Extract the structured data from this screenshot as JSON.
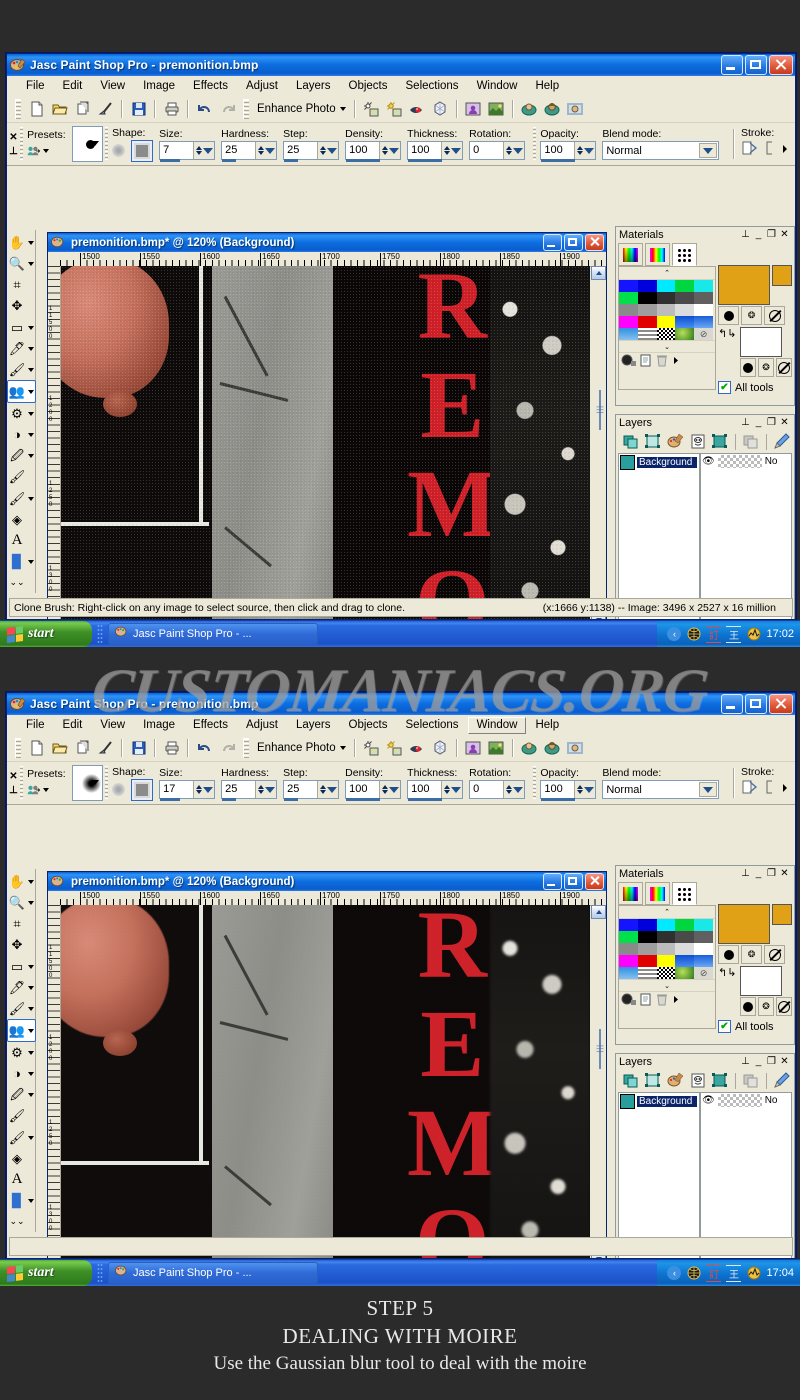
{
  "app": {
    "title": "Jasc Paint Shop Pro - premonition.bmp",
    "menu": [
      "File",
      "Edit",
      "View",
      "Image",
      "Effects",
      "Adjust",
      "Layers",
      "Objects",
      "Selections",
      "Window",
      "Help"
    ],
    "toolbar": {
      "enhance_label": "Enhance Photo",
      "icons": [
        "new-file-icon",
        "open-folder-icon",
        "browse-icon",
        "twain-acquire-icon",
        "save-icon",
        "print-icon",
        "undo-icon",
        "redo-icon",
        "auto-contrast-icon",
        "auto-brightness-icon",
        "red-eye-icon",
        "clarify-icon",
        "photo-person-icon",
        "photo-landscape-icon",
        "photo-frame-icon",
        "photo-vignette-icon",
        "photo-edge-icon"
      ]
    }
  },
  "tool_options": {
    "presets_label": "Presets:",
    "shape_label": "Shape:",
    "size_label": "Size:",
    "hardness_label": "Hardness:",
    "step_label": "Step:",
    "density_label": "Density:",
    "thickness_label": "Thickness:",
    "rotation_label": "Rotation:",
    "opacity_label": "Opacity:",
    "blend_label": "Blend mode:",
    "stroke_label": "Stroke:",
    "blend_value": "Normal",
    "window1": {
      "size": "7",
      "hardness": "25",
      "step": "25",
      "density": "100",
      "thickness": "100",
      "rotation": "0",
      "opacity": "100"
    },
    "window2": {
      "size": "17",
      "hardness": "25",
      "step": "25",
      "density": "100",
      "thickness": "100",
      "rotation": "0",
      "opacity": "100"
    }
  },
  "tools_palette": [
    {
      "name": "pan-tool",
      "glyph": "✋",
      "arrow": true
    },
    {
      "name": "zoom-tool",
      "glyph": "🔍",
      "arrow": true
    },
    {
      "name": "crop-tool",
      "glyph": "⌗",
      "arrow": false
    },
    {
      "name": "move-tool",
      "glyph": "✥",
      "arrow": false
    },
    {
      "name": "selection-tool",
      "glyph": "▭",
      "arrow": true
    },
    {
      "name": "dropper-tool",
      "glyph": "✒",
      "arrow": true
    },
    {
      "name": "paint-brush-tool",
      "glyph": "🖌",
      "arrow": true
    },
    {
      "name": "clone-brush-tool",
      "glyph": "👥",
      "arrow": true
    },
    {
      "name": "scratch-remover-tool",
      "glyph": "⚙",
      "arrow": true
    },
    {
      "name": "dodge-burn-tool",
      "glyph": "◑",
      "arrow": true
    },
    {
      "name": "smudge-tool",
      "glyph": "✏",
      "arrow": true
    },
    {
      "name": "eraser-tool",
      "glyph": "🖍",
      "arrow": false
    },
    {
      "name": "picture-tube-tool",
      "glyph": "🖌",
      "arrow": true
    },
    {
      "name": "flood-fill-tool",
      "glyph": "◈",
      "arrow": false
    },
    {
      "name": "text-tool",
      "glyph": "A",
      "arrow": false
    },
    {
      "name": "preset-shape-tool",
      "glyph": "▧",
      "arrow": true
    },
    {
      "name": "more-tools",
      "glyph": "⌄",
      "arrow": false
    }
  ],
  "image_window": {
    "title": "premonition.bmp* @ 120% (Background)",
    "ruler_ticks": [
      "1500",
      "1550",
      "1600",
      "1650",
      "1700",
      "1750",
      "1800",
      "1850",
      "1900"
    ],
    "vruler_ticks": [
      "1",
      "1",
      "5",
      "0",
      "0",
      "1",
      "2",
      "0",
      "0",
      "1",
      "2",
      "5",
      "0",
      "1",
      "3",
      "0",
      "0"
    ]
  },
  "materials": {
    "title": "Materials",
    "all_tools_label": "All tools",
    "tabs": [
      "frame-tab",
      "rainbow-tab",
      "swatches-tab"
    ],
    "foreground_color": "#e0a116",
    "background_color": "#ffffff",
    "swatches": [
      "#0000ff",
      "#0000ee",
      "#00ffff",
      "#00e000",
      "#00f0f0",
      "#00e840",
      "#000000",
      "#303030",
      "#484848",
      "#606060",
      "#808080",
      "#969696",
      "#b4b4b4",
      "#d0d0d0",
      "#ffffff",
      "#ff00ff",
      "#e00000",
      "#ffff00",
      "#1050e0",
      "#2060d0",
      "#3090e0",
      "#b0b0b0",
      "#888888",
      "#40c040",
      "#c8c8c8"
    ],
    "icons": [
      "color-wheel-icon",
      "copy-material-icon",
      "delete-material-icon",
      "more-arrow-icon",
      "fg-texture-icon",
      "fg-null-icon",
      "bg-texture-icon",
      "bg-null-icon",
      "swap-colors-icon"
    ]
  },
  "layers": {
    "title": "Layers",
    "layer_name": "Background",
    "blend_column": "No",
    "toolbar_icons": [
      "new-raster-layer-icon",
      "new-vector-layer-icon",
      "new-art-media-layer-icon",
      "new-mask-layer-icon",
      "new-layer-group-icon",
      "duplicate-layer-icon",
      "layer-properties-icon"
    ]
  },
  "status_bar": {
    "hint": "Clone Brush: Right-click on any image to select source, then click and drag to clone.",
    "coords": "(x:1666 y:1138) -- Image:  3496 x 2527 x 16 million"
  },
  "taskbar": {
    "start_label": "start",
    "task_label": "Jasc Paint Shop Pro - ...",
    "tray_icons": [
      "network-icon",
      "ime-red-icon",
      "ime-blue-icon",
      "volume-icon"
    ],
    "time_window1": "17:02",
    "time_window2": "17:04"
  },
  "watermark": "CUSTOMANIACS.ORG",
  "caption": {
    "line1": "STEP 5",
    "line2": "DEALING WITH MOIRE",
    "line3": "Use the Gaussian blur tool to deal with the moire"
  },
  "artwork": {
    "poster_text": "REMO"
  }
}
